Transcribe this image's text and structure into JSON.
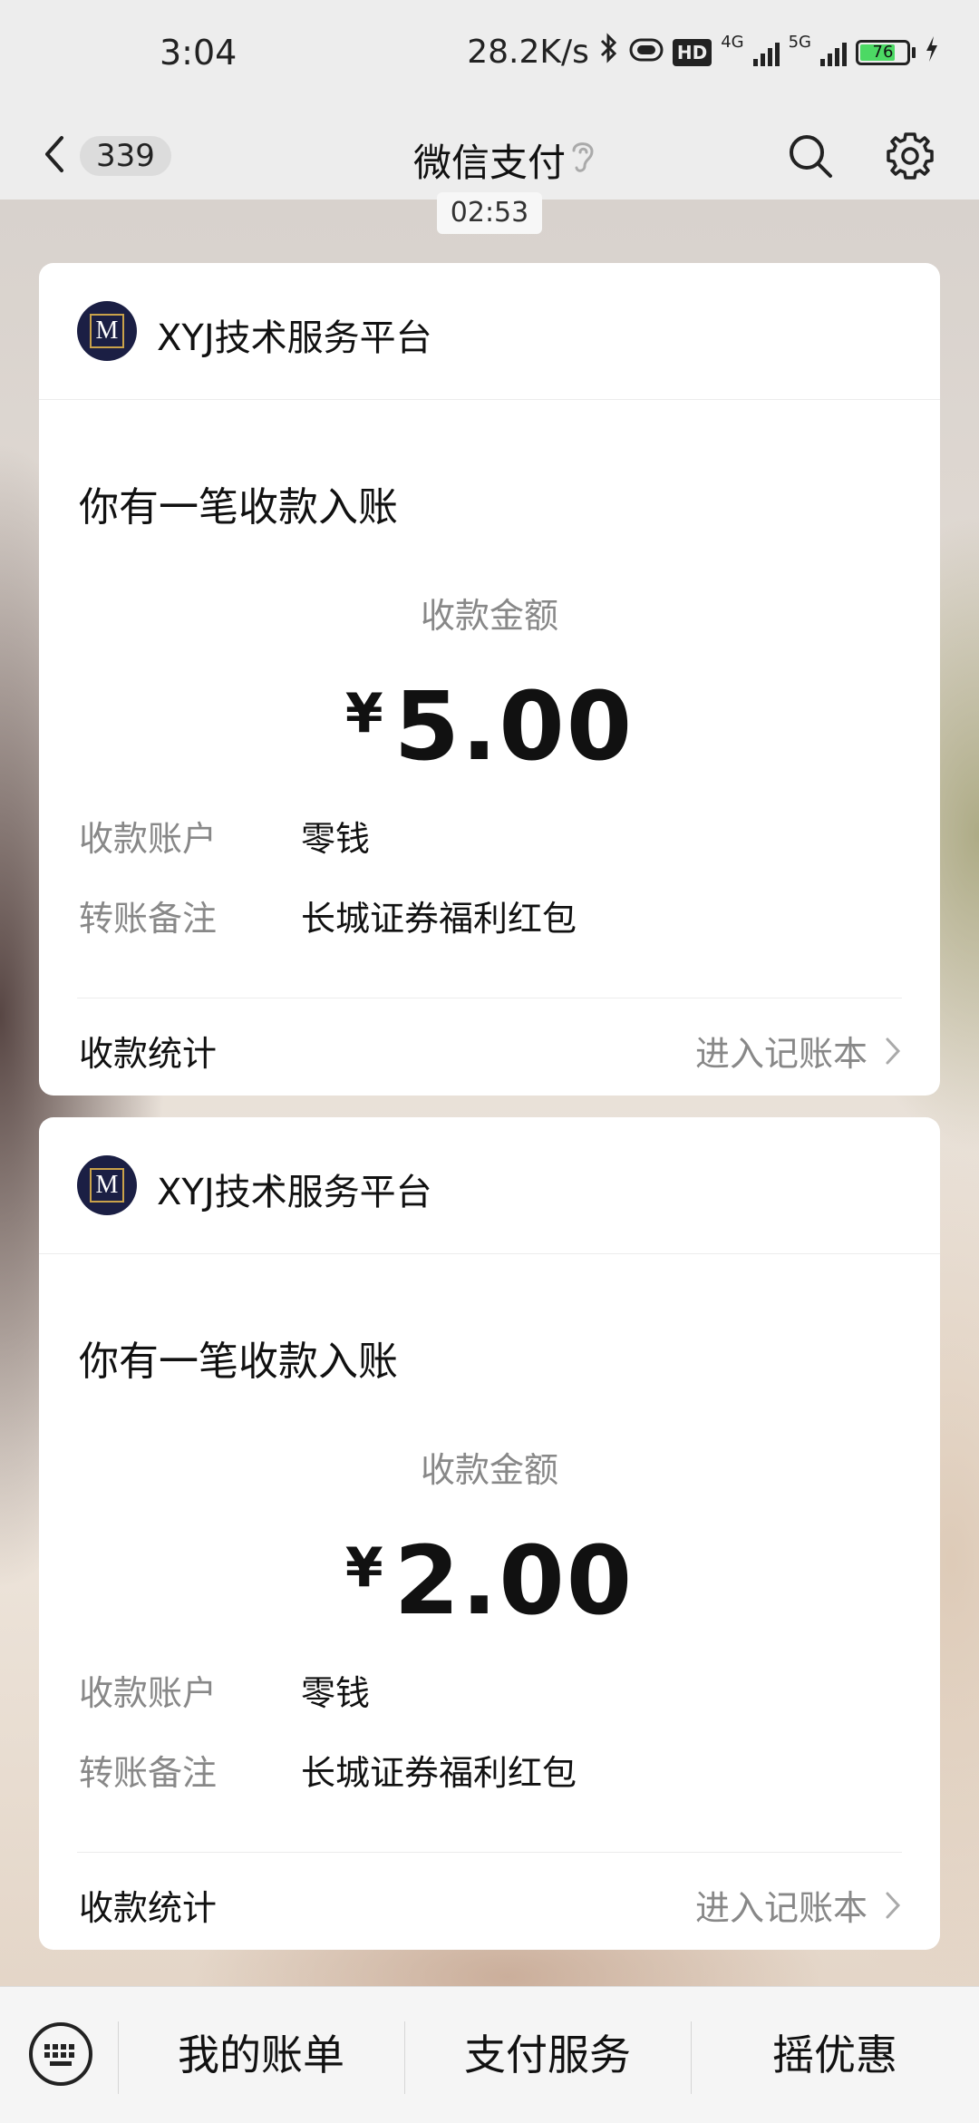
{
  "status_bar": {
    "time": "3:04",
    "net_speed": "28.2K/s",
    "hd_label": "HD",
    "net1": "4G",
    "net2": "5G",
    "battery": "76",
    "battery_fraction": 0.76
  },
  "nav": {
    "unread_count": "339",
    "title": "微信支付"
  },
  "timestamp": "02:53",
  "cards": [
    {
      "merchant": "XYJ技术服务平台",
      "logo_letter": "M",
      "notice": "你有一笔收款入账",
      "amount_label": "收款金额",
      "currency": "¥",
      "amount": "5.00",
      "account_key": "收款账户",
      "account_value": "零钱",
      "remark_key": "转账备注",
      "remark_value": "长城证券福利红包",
      "stats_label": "收款统计",
      "ledger_link": "进入记账本"
    },
    {
      "merchant": "XYJ技术服务平台",
      "logo_letter": "M",
      "notice": "你有一笔收款入账",
      "amount_label": "收款金额",
      "currency": "¥",
      "amount": "2.00",
      "account_key": "收款账户",
      "account_value": "零钱",
      "remark_key": "转账备注",
      "remark_value": "长城证券福利红包",
      "stats_label": "收款统计",
      "ledger_link": "进入记账本"
    }
  ],
  "bottom_menu": [
    "我的账单",
    "支付服务",
    "摇优惠"
  ],
  "colors": {
    "background": "#ededed",
    "card": "#ffffff",
    "muted_text": "#888888",
    "battery_green": "#4cd964"
  }
}
